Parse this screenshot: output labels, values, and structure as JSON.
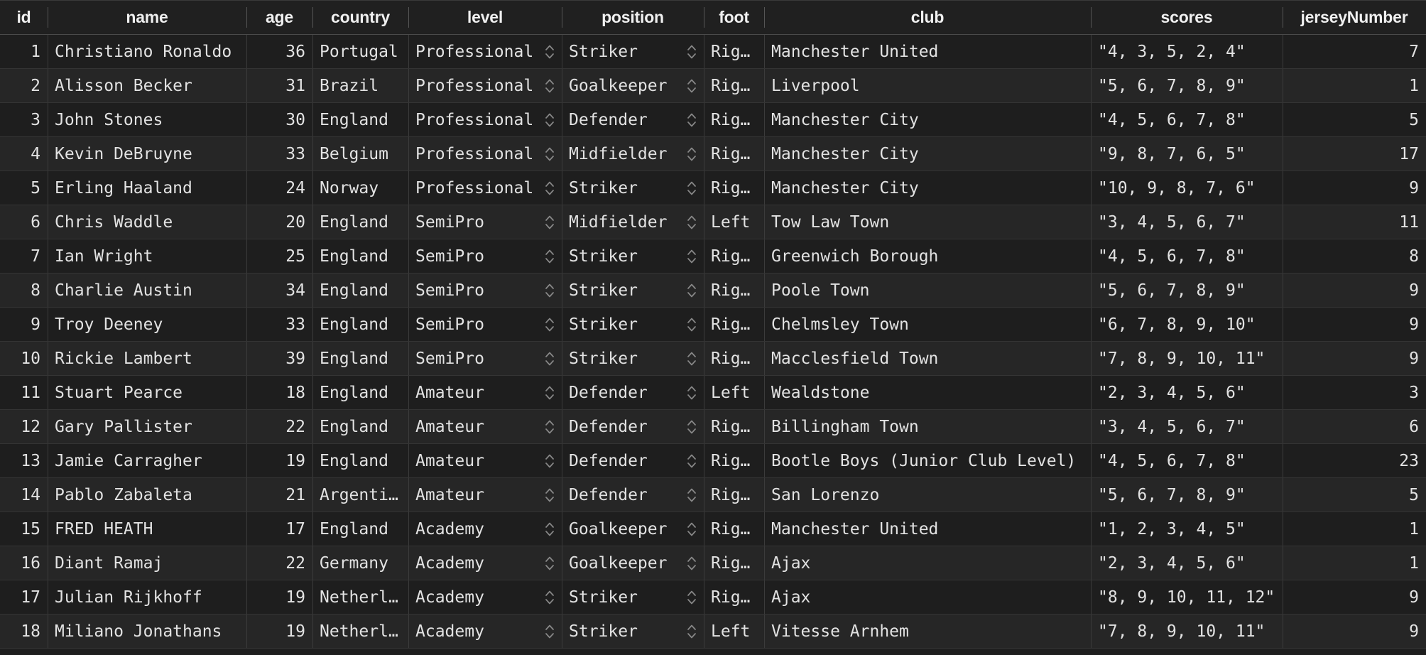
{
  "table": {
    "columns": [
      {
        "key": "id",
        "label": "id",
        "align": "right",
        "type": "number"
      },
      {
        "key": "name",
        "label": "name",
        "align": "left",
        "type": "text"
      },
      {
        "key": "age",
        "label": "age",
        "align": "right",
        "type": "number"
      },
      {
        "key": "country",
        "label": "country",
        "align": "left",
        "type": "text"
      },
      {
        "key": "level",
        "label": "level",
        "align": "left",
        "type": "select"
      },
      {
        "key": "position",
        "label": "position",
        "align": "left",
        "type": "select"
      },
      {
        "key": "foot",
        "label": "foot",
        "align": "left",
        "type": "text"
      },
      {
        "key": "club",
        "label": "club",
        "align": "left",
        "type": "text"
      },
      {
        "key": "scores",
        "label": "scores",
        "align": "left",
        "type": "text"
      },
      {
        "key": "jerseyNumber",
        "label": "jerseyNumber",
        "align": "right",
        "type": "number"
      }
    ],
    "select_icon": "stepper-chevron-icon",
    "rows": [
      {
        "id": "1",
        "name": "Christiano Ronaldo",
        "age": "36",
        "country": "Portugal",
        "level": "Professional",
        "position": "Striker",
        "foot": "Right",
        "club": "Manchester United",
        "scores": "\"4, 3, 5, 2, 4\"",
        "jerseyNumber": "7"
      },
      {
        "id": "2",
        "name": "Alisson Becker",
        "age": "31",
        "country": "Brazil",
        "level": "Professional",
        "position": "Goalkeeper",
        "foot": "Right",
        "club": "Liverpool",
        "scores": "\"5, 6, 7, 8, 9\"",
        "jerseyNumber": "1"
      },
      {
        "id": "3",
        "name": "John Stones",
        "age": "30",
        "country": "England",
        "level": "Professional",
        "position": "Defender",
        "foot": "Right",
        "club": "Manchester City",
        "scores": "\"4, 5, 6, 7, 8\"",
        "jerseyNumber": "5"
      },
      {
        "id": "4",
        "name": "Kevin DeBruyne",
        "age": "33",
        "country": "Belgium",
        "level": "Professional",
        "position": "Midfielder",
        "foot": "Right",
        "club": "Manchester City",
        "scores": "\"9, 8, 7, 6, 5\"",
        "jerseyNumber": "17"
      },
      {
        "id": "5",
        "name": "Erling Haaland",
        "age": "24",
        "country": "Norway",
        "level": "Professional",
        "position": "Striker",
        "foot": "Right",
        "club": "Manchester City",
        "scores": "\"10, 9, 8, 7, 6\"",
        "jerseyNumber": "9"
      },
      {
        "id": "6",
        "name": "Chris Waddle",
        "age": "20",
        "country": "England",
        "level": "SemiPro",
        "position": "Midfielder",
        "foot": "Left",
        "club": "Tow Law Town",
        "scores": "\"3, 4, 5, 6, 7\"",
        "jerseyNumber": "11"
      },
      {
        "id": "7",
        "name": "Ian Wright",
        "age": "25",
        "country": "England",
        "level": "SemiPro",
        "position": "Striker",
        "foot": "Right",
        "club": "Greenwich Borough",
        "scores": "\"4, 5, 6, 7, 8\"",
        "jerseyNumber": "8"
      },
      {
        "id": "8",
        "name": "Charlie Austin",
        "age": "34",
        "country": "England",
        "level": "SemiPro",
        "position": "Striker",
        "foot": "Right",
        "club": "Poole Town",
        "scores": "\"5, 6, 7, 8, 9\"",
        "jerseyNumber": "9"
      },
      {
        "id": "9",
        "name": "Troy Deeney",
        "age": "33",
        "country": "England",
        "level": "SemiPro",
        "position": "Striker",
        "foot": "Right",
        "club": "Chelmsley Town",
        "scores": "\"6, 7, 8, 9, 10\"",
        "jerseyNumber": "9"
      },
      {
        "id": "10",
        "name": "Rickie Lambert",
        "age": "39",
        "country": "England",
        "level": "SemiPro",
        "position": "Striker",
        "foot": "Right",
        "club": "Macclesfield Town",
        "scores": "\"7, 8, 9, 10, 11\"",
        "jerseyNumber": "9"
      },
      {
        "id": "11",
        "name": "Stuart Pearce",
        "age": "18",
        "country": "England",
        "level": "Amateur",
        "position": "Defender",
        "foot": "Left",
        "club": "Wealdstone",
        "scores": "\"2, 3, 4, 5, 6\"",
        "jerseyNumber": "3"
      },
      {
        "id": "12",
        "name": "Gary Pallister",
        "age": "22",
        "country": "England",
        "level": "Amateur",
        "position": "Defender",
        "foot": "Right",
        "club": "Billingham Town",
        "scores": "\"3, 4, 5, 6, 7\"",
        "jerseyNumber": "6"
      },
      {
        "id": "13",
        "name": "Jamie Carragher",
        "age": "19",
        "country": "England",
        "level": "Amateur",
        "position": "Defender",
        "foot": "Right",
        "club": "Bootle Boys (Junior Club Level)",
        "scores": "\"4, 5, 6, 7, 8\"",
        "jerseyNumber": "23"
      },
      {
        "id": "14",
        "name": "Pablo Zabaleta",
        "age": "21",
        "country": "Argentina",
        "level": "Amateur",
        "position": "Defender",
        "foot": "Right",
        "club": "San Lorenzo",
        "scores": "\"5, 6, 7, 8, 9\"",
        "jerseyNumber": "5"
      },
      {
        "id": "15",
        "name": "FRED HEATH",
        "age": "17",
        "country": "England",
        "level": "Academy",
        "position": "Goalkeeper",
        "foot": "Right",
        "club": "Manchester United",
        "scores": "\"1, 2, 3, 4, 5\"",
        "jerseyNumber": "1"
      },
      {
        "id": "16",
        "name": "Diant Ramaj",
        "age": "22",
        "country": "Germany",
        "level": "Academy",
        "position": "Goalkeeper",
        "foot": "Right",
        "club": "Ajax",
        "scores": "\"2, 3, 4, 5, 6\"",
        "jerseyNumber": "1"
      },
      {
        "id": "17",
        "name": "Julian Rijkhoff",
        "age": "19",
        "country": "Netherla…",
        "level": "Academy",
        "position": "Striker",
        "foot": "Right",
        "club": "Ajax",
        "scores": "\"8, 9, 10, 11, 12\"",
        "jerseyNumber": "9"
      },
      {
        "id": "18",
        "name": "Miliano Jonathans",
        "age": "19",
        "country": "Netherla…",
        "level": "Academy",
        "position": "Striker",
        "foot": "Left",
        "club": "Vitesse Arnhem",
        "scores": "\"7, 8, 9, 10, 11\"",
        "jerseyNumber": "9"
      }
    ]
  },
  "colors": {
    "background": "#1e1e1e",
    "header_background": "#202020",
    "row_odd": "#1e1e1e",
    "row_even": "#262626",
    "text": "#e2e2e2",
    "header_text": "#f0f0f0",
    "border": "#3b3b3b",
    "header_border": "#4a4a4a"
  }
}
